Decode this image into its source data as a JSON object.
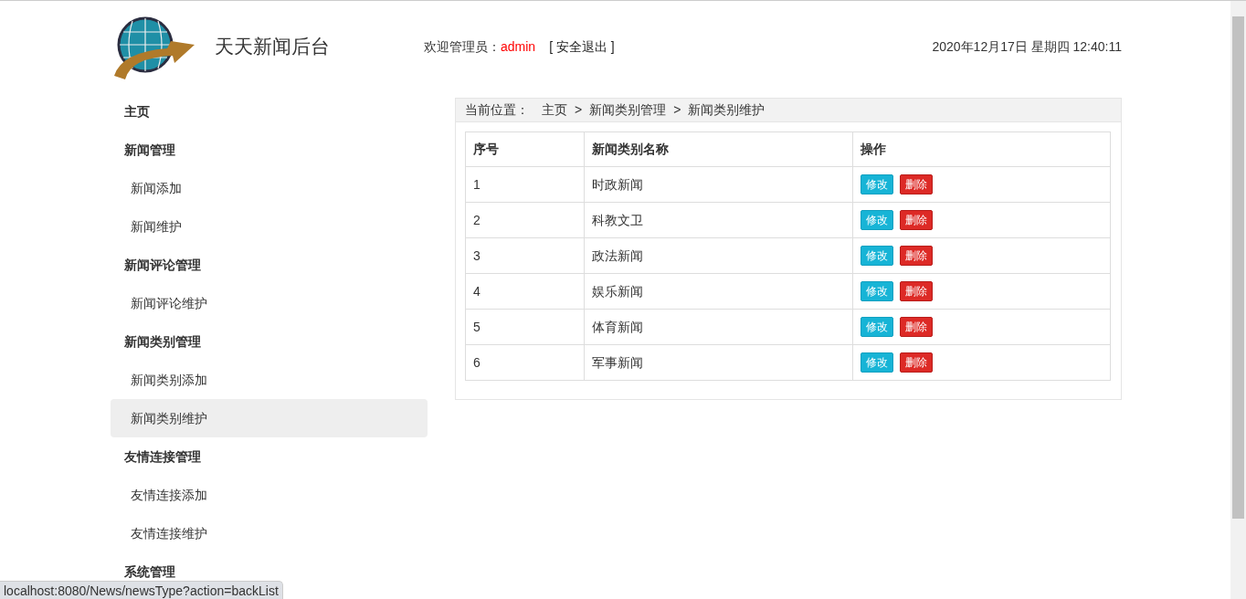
{
  "header": {
    "site_title": "天天新闻后台",
    "welcome_label": "欢迎管理员：",
    "username": "admin",
    "logout": "[ 安全退出 ]",
    "datetime": "2020年12月17日 星期四 12:40:11"
  },
  "sidebar": {
    "items": [
      {
        "kind": "group",
        "label": "主页",
        "selected": false
      },
      {
        "kind": "group",
        "label": "新闻管理",
        "selected": false
      },
      {
        "kind": "link",
        "label": "新闻添加",
        "selected": false
      },
      {
        "kind": "link",
        "label": "新闻维护",
        "selected": false
      },
      {
        "kind": "group",
        "label": "新闻评论管理",
        "selected": false
      },
      {
        "kind": "link",
        "label": "新闻评论维护",
        "selected": false
      },
      {
        "kind": "group",
        "label": "新闻类别管理",
        "selected": false
      },
      {
        "kind": "link",
        "label": "新闻类别添加",
        "selected": false
      },
      {
        "kind": "link",
        "label": "新闻类别维护",
        "selected": true
      },
      {
        "kind": "group",
        "label": "友情连接管理",
        "selected": false
      },
      {
        "kind": "link",
        "label": "友情连接添加",
        "selected": false
      },
      {
        "kind": "link",
        "label": "友情连接维护",
        "selected": false
      },
      {
        "kind": "group",
        "label": "系统管理",
        "selected": false
      }
    ]
  },
  "breadcrumb": {
    "label": "当前位置：",
    "separator": ">",
    "items": [
      "主页",
      "新闻类别管理",
      "新闻类别维护"
    ]
  },
  "table": {
    "columns": [
      "序号",
      "新闻类别名称",
      "操作"
    ],
    "rows": [
      {
        "index": "1",
        "name": "时政新闻",
        "edit": "修改",
        "delete": "删除"
      },
      {
        "index": "2",
        "name": "科教文卫",
        "edit": "修改",
        "delete": "删除"
      },
      {
        "index": "3",
        "name": "政法新闻",
        "edit": "修改",
        "delete": "删除"
      },
      {
        "index": "4",
        "name": "娱乐新闻",
        "edit": "修改",
        "delete": "删除"
      },
      {
        "index": "5",
        "name": "体育新闻",
        "edit": "修改",
        "delete": "删除"
      },
      {
        "index": "6",
        "name": "军事新闻",
        "edit": "修改",
        "delete": "删除"
      }
    ]
  },
  "status_bar": {
    "url": "localhost:8080/News/newsType?action=backList"
  }
}
